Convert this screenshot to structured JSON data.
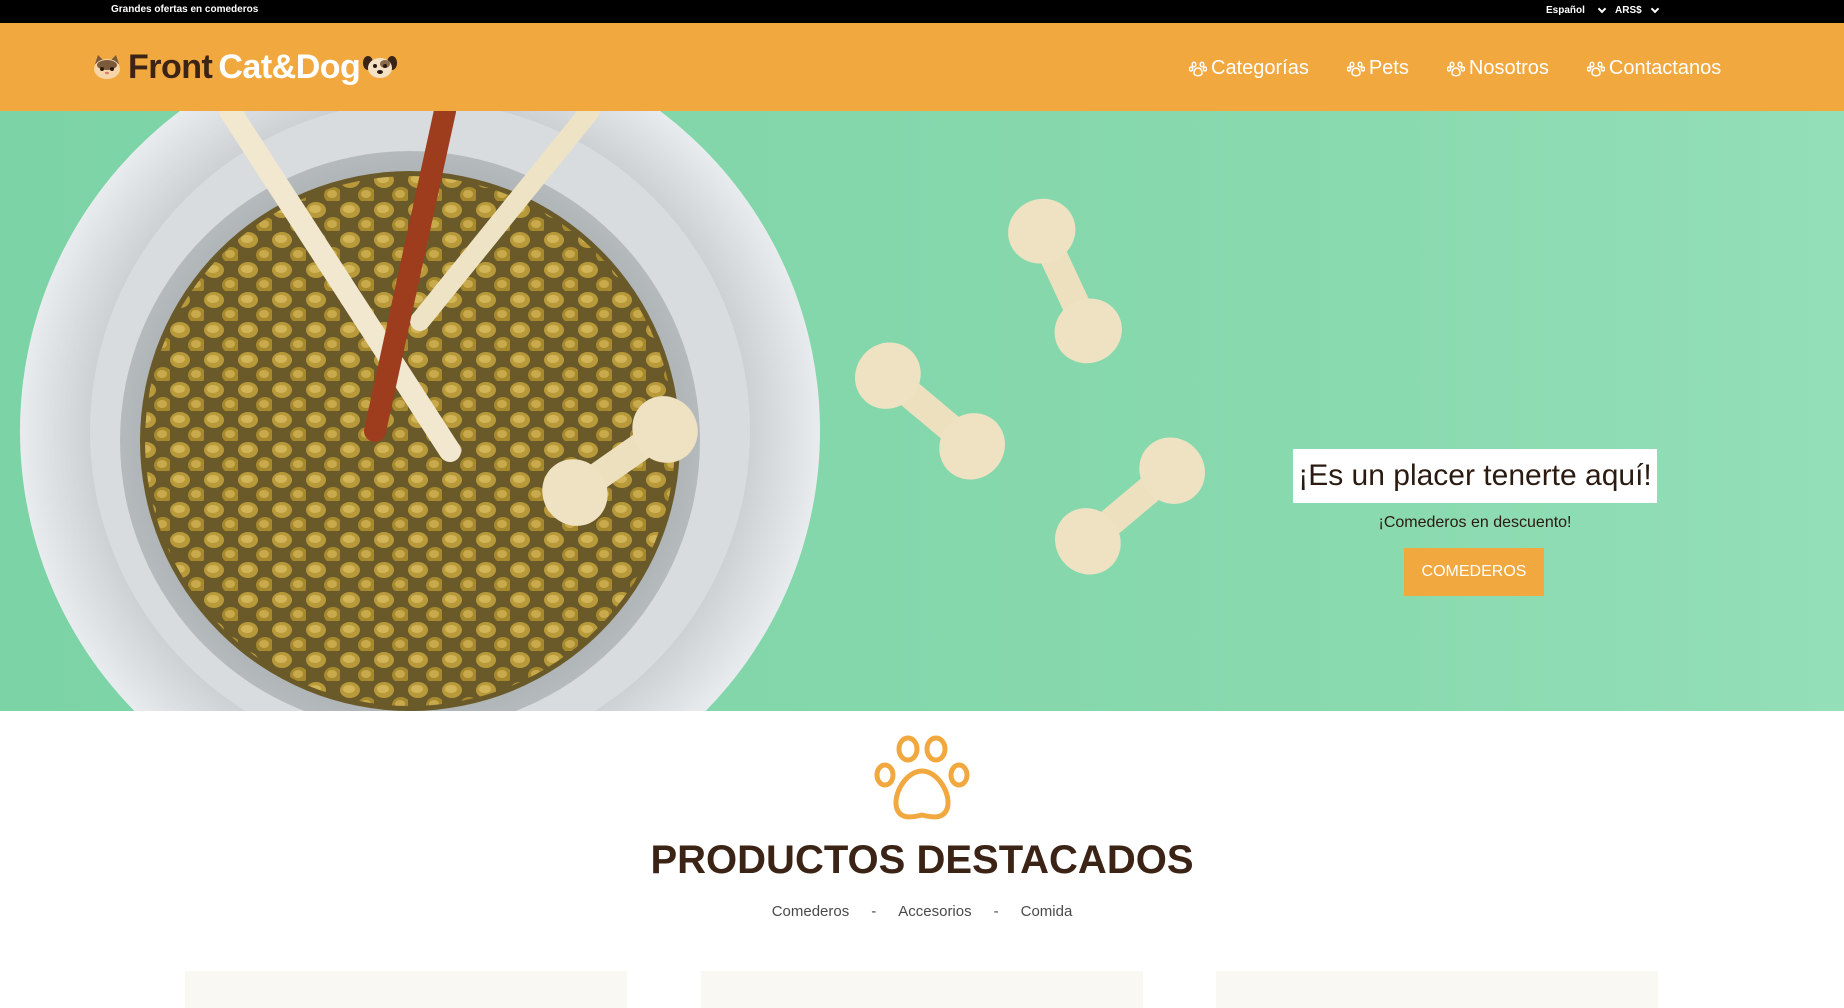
{
  "topbar": {
    "promo": "Grandes ofertas en comederos",
    "language": "Español",
    "currency": "ARS$"
  },
  "brand": {
    "part1": "Front",
    "part2": "Cat&Dog"
  },
  "nav": [
    {
      "label": "Categorías"
    },
    {
      "label": "Pets"
    },
    {
      "label": "Nosotros"
    },
    {
      "label": "Contactanos"
    }
  ],
  "hero": {
    "title": "¡Es un placer tenerte aquí!",
    "subtitle": "¡Comederos en descuento!",
    "button": "COMEDEROS"
  },
  "featured": {
    "title": "PRODUCTOS DESTACADOS",
    "filters": [
      "Comederos",
      "Accesorios",
      "Comida"
    ],
    "separator": "-"
  },
  "colors": {
    "accent": "#f1a83f",
    "brown": "#3b2415",
    "hero_bg": "#88d9ae"
  }
}
